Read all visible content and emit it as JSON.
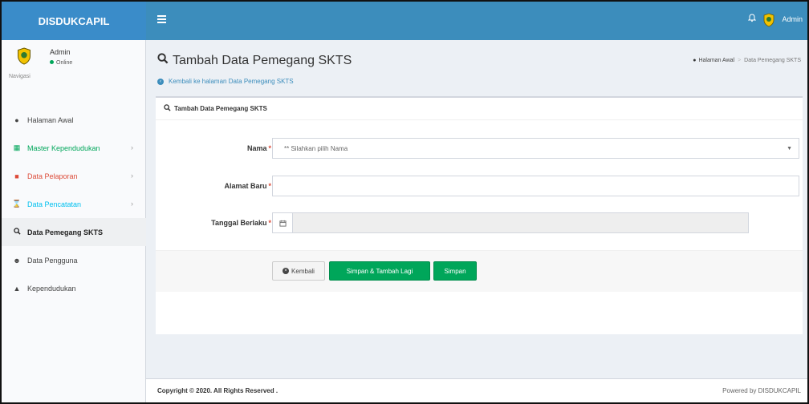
{
  "brand": {
    "name": "DISDUKCAPIL"
  },
  "topbar": {
    "user_name": "Admin",
    "user_icon": "emblem-icon",
    "notification_icon": "bell-icon"
  },
  "sidebar": {
    "user": {
      "name": "Admin",
      "status": "Online"
    },
    "nav_header": "Navigasi",
    "items": [
      {
        "label": "Halaman Awal",
        "icon": "dashboard-icon",
        "color": "#444444"
      },
      {
        "label": "Master Kependudukan",
        "icon": "grid-icon",
        "color": "#00a65a"
      },
      {
        "label": "Data Pelaporan",
        "icon": "book-icon",
        "color": "#dd4b39"
      },
      {
        "label": "Data Pencatatan",
        "icon": "hourglass-icon",
        "color": "#00c0ef"
      },
      {
        "label": "Data Pemegang SKTS",
        "icon": "search-icon",
        "color": "#222222",
        "active": true
      },
      {
        "label": "Data Pengguna",
        "icon": "users-icon",
        "color": "#444444"
      },
      {
        "label": "Kependudukan",
        "icon": "user-icon",
        "color": "#444444"
      }
    ]
  },
  "content": {
    "title": "Tambah Data Pemegang SKTS",
    "back_link": "Kembali ke halaman Data Pemegang SKTS",
    "breadcrumb": {
      "home": "Halaman Awal",
      "current": "Data Pemegang SKTS"
    },
    "box": {
      "title": "Tambah Data Pemegang SKTS",
      "fields": {
        "nama": {
          "label": "Nama",
          "required_mark": "*",
          "placeholder": "** Silahkan pilih Nama"
        },
        "alamat": {
          "label": "Alamat Baru",
          "required_mark": "*",
          "value": ""
        },
        "tanggal": {
          "label": "Tanggal Berlaku",
          "required_mark": "*",
          "value": ""
        }
      },
      "buttons": {
        "back": "Kembali",
        "save_add": "Simpan & Tambah Lagi",
        "save": "Simpan"
      }
    }
  },
  "footer": {
    "copyright": "Copyright © 2020. All Rights Reserved .",
    "powered": "Powered by DISDUKCAPIL"
  },
  "colors": {
    "primary": "#3c8dbc",
    "success": "#00a65a",
    "danger": "#dd4b39",
    "info": "#00c0ef"
  }
}
